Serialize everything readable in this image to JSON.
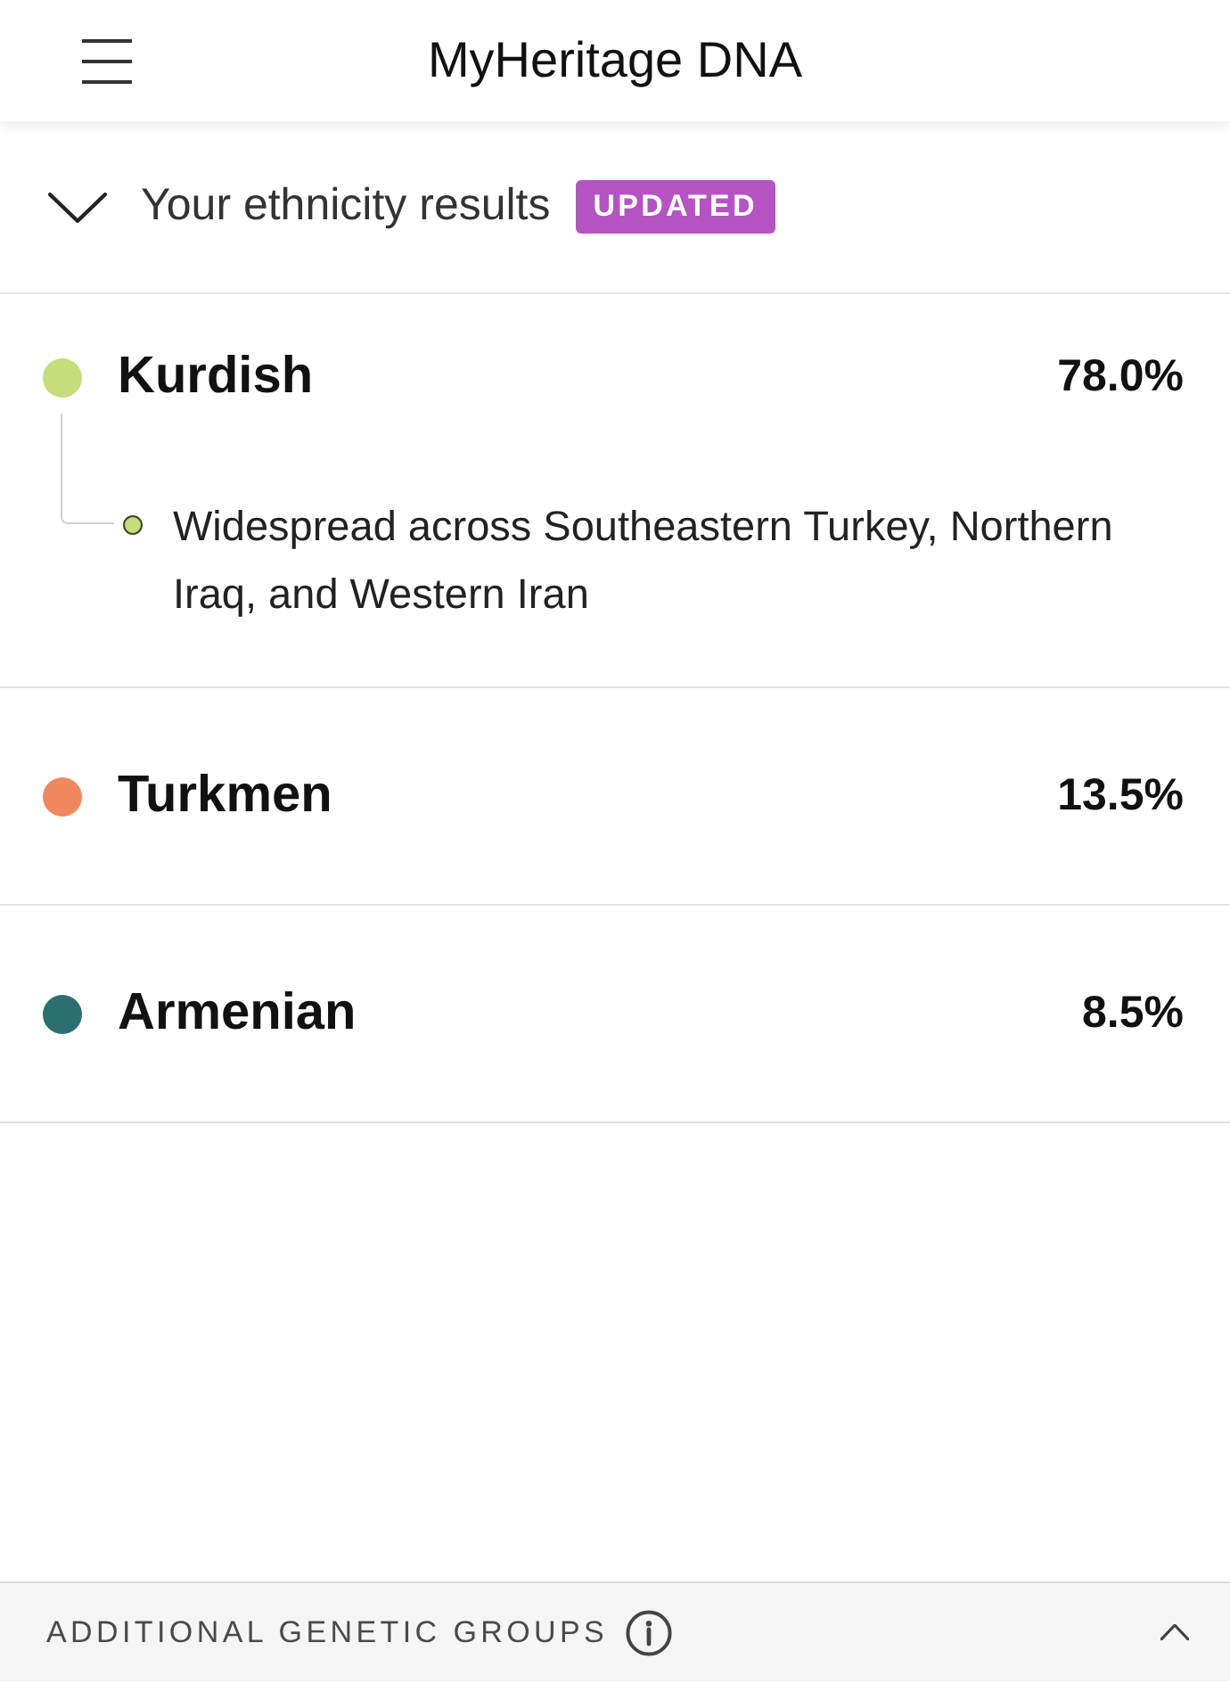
{
  "header": {
    "title": "MyHeritage DNA"
  },
  "section": {
    "title": "Your ethnicity results",
    "badge": "UPDATED",
    "expanded": true
  },
  "ethnicities": [
    {
      "name": "Kurdish",
      "percent": "78.0%",
      "color": "#c5dd7a",
      "children": [
        {
          "name": "Widespread across Southeastern Turkey, Northern Iraq, and Western Iran",
          "color": "#c5dd7a"
        }
      ]
    },
    {
      "name": "Turkmen",
      "percent": "13.5%",
      "color": "#f0875d"
    },
    {
      "name": "Armenian",
      "percent": "8.5%",
      "color": "#2a7071"
    }
  ],
  "footer": {
    "label": "ADDITIONAL GENETIC GROUPS",
    "expanded": false
  }
}
